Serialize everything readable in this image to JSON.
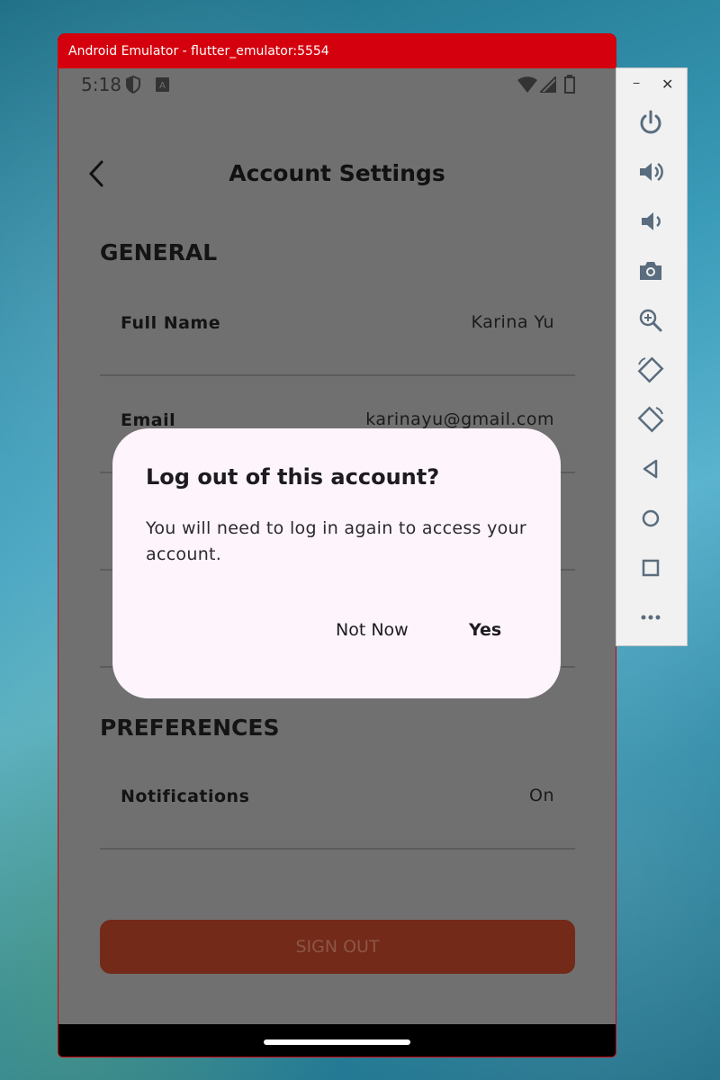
{
  "emulator": {
    "title": "Android Emulator - flutter_emulator:5554"
  },
  "status_bar": {
    "time": "5:18",
    "icons": [
      "shield-icon",
      "keyboard-a-icon",
      "wifi-icon",
      "signal-icon",
      "battery-icon"
    ]
  },
  "header": {
    "title": "Account Settings",
    "back_icon": "chevron-left-icon"
  },
  "general": {
    "title": "GENERAL",
    "rows": [
      {
        "label": "Full Name",
        "value": "Karina Yu"
      },
      {
        "label": "Email",
        "value": "karinayu@gmail.com"
      }
    ]
  },
  "preferences": {
    "title": "PREFERENCES",
    "rows": [
      {
        "label": "Notifications",
        "value": "On"
      }
    ]
  },
  "sign_out_label": "SIGN OUT",
  "dialog": {
    "title": "Log out of this account?",
    "body": "You will need to log in again to access your account.",
    "cancel_label": "Not Now",
    "confirm_label": "Yes"
  },
  "toolbar": {
    "minimize": "−",
    "close": "✕",
    "buttons": [
      "power-icon",
      "volume-up-icon",
      "volume-down-icon",
      "camera-icon",
      "zoom-icon",
      "rotate-left-icon",
      "rotate-right-icon",
      "back-icon",
      "home-icon",
      "overview-icon",
      "more-icon"
    ]
  },
  "colors": {
    "title_bar": "#d4000d",
    "scrim": "#707070",
    "dialog_bg": "#fdf4fc",
    "sign_out_bg": "#732a18"
  }
}
